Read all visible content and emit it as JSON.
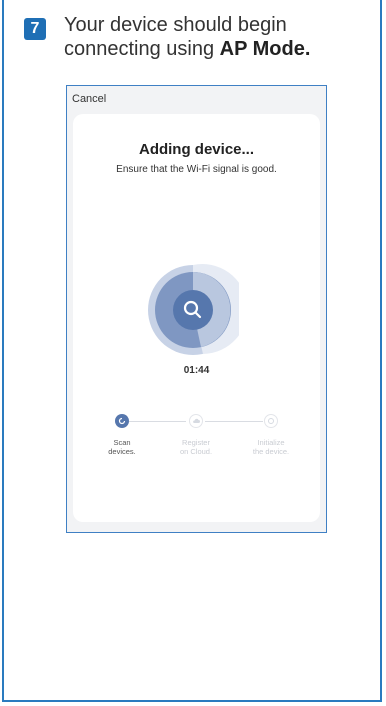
{
  "instruction": {
    "step_number": "7",
    "text_prefix": "Your device should begin connecting using ",
    "text_bold": "AP Mode."
  },
  "screen": {
    "cancel_label": "Cancel",
    "title": "Adding device...",
    "subtitle": "Ensure that the Wi-Fi signal is good.",
    "timer": "01:44",
    "steps": [
      {
        "label_line1": "Scan",
        "label_line2": "devices.",
        "active": true
      },
      {
        "label_line1": "Register",
        "label_line2": "on Cloud.",
        "active": false
      },
      {
        "label_line1": "Initialize",
        "label_line2": "the device.",
        "active": false
      }
    ]
  },
  "colors": {
    "accent_blue": "#1f6fb5",
    "radar_blue": "#5677ad",
    "radar_ring": "#a9b9d6"
  }
}
